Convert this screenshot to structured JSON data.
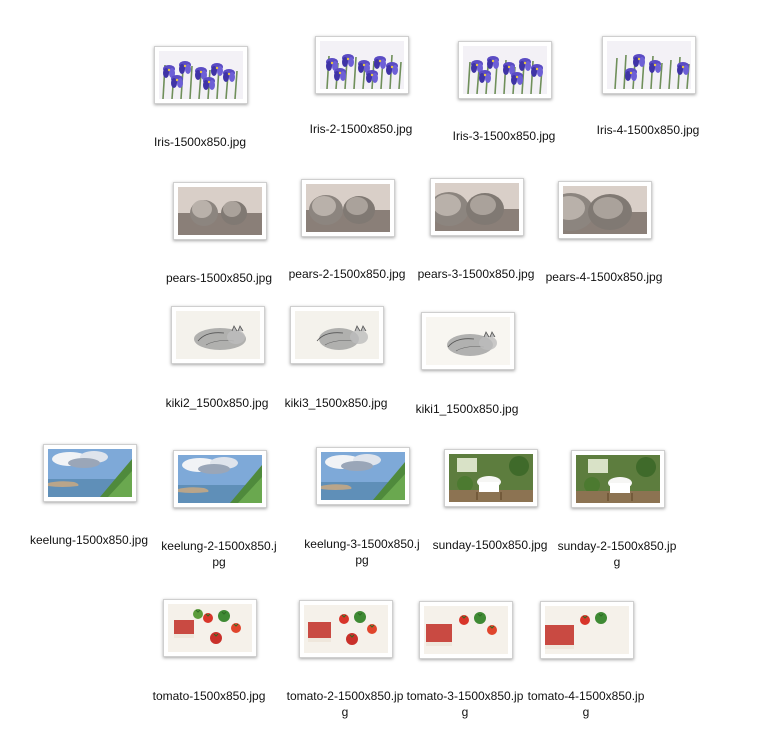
{
  "window": {
    "background": "#ffffff"
  },
  "files": [
    {
      "name": "Iris-1500x850.jpg",
      "subject": "iris flowers painting",
      "icon": "image-thumbnail"
    },
    {
      "name": "Iris-2-1500x850.jpg",
      "subject": "iris flowers painting",
      "icon": "image-thumbnail"
    },
    {
      "name": "Iris-3-1500x850.jpg",
      "subject": "iris flowers painting",
      "icon": "image-thumbnail"
    },
    {
      "name": "Iris-4-1500x850.jpg",
      "subject": "iris flowers painting",
      "icon": "image-thumbnail"
    },
    {
      "name": "pears-1500x850.jpg",
      "subject": "pears sketch",
      "icon": "image-thumbnail"
    },
    {
      "name": "pears-2-1500x850.jpg",
      "subject": "pears sketch",
      "icon": "image-thumbnail"
    },
    {
      "name": "pears-3-1500x850.jpg",
      "subject": "pears sketch",
      "icon": "image-thumbnail"
    },
    {
      "name": "pears-4-1500x850.jpg",
      "subject": "pears sketch",
      "icon": "image-thumbnail"
    },
    {
      "name": "kiki2_1500x850.jpg",
      "subject": "sleeping cat sketch",
      "icon": "image-thumbnail"
    },
    {
      "name": "kiki3_1500x850.jpg",
      "subject": "sleeping cat sketch",
      "icon": "image-thumbnail"
    },
    {
      "name": "kiki1_1500x850.jpg",
      "subject": "sleeping cat sketch",
      "icon": "image-thumbnail"
    },
    {
      "name": "keelung-1500x850.jpg",
      "subject": "coastal landscape watercolor",
      "icon": "image-thumbnail"
    },
    {
      "name": "keelung-2-1500x850.jpg",
      "subject": "coastal landscape watercolor",
      "icon": "image-thumbnail"
    },
    {
      "name": "keelung-3-1500x850.jpg",
      "subject": "coastal landscape watercolor",
      "icon": "image-thumbnail"
    },
    {
      "name": "sunday-1500x850.jpg",
      "subject": "garden table painting",
      "icon": "image-thumbnail"
    },
    {
      "name": "sunday-2-1500x850.jpg",
      "subject": "garden table painting",
      "icon": "image-thumbnail"
    },
    {
      "name": "tomato-1500x850.jpg",
      "subject": "tomatoes still life",
      "icon": "image-thumbnail"
    },
    {
      "name": "tomato-2-1500x850.jpg",
      "subject": "tomatoes still life",
      "icon": "image-thumbnail"
    },
    {
      "name": "tomato-3-1500x850.jpg",
      "subject": "tomatoes still life",
      "icon": "image-thumbnail"
    },
    {
      "name": "tomato-4-1500x850.jpg",
      "subject": "tomatoes still life",
      "icon": "image-thumbnail"
    }
  ]
}
